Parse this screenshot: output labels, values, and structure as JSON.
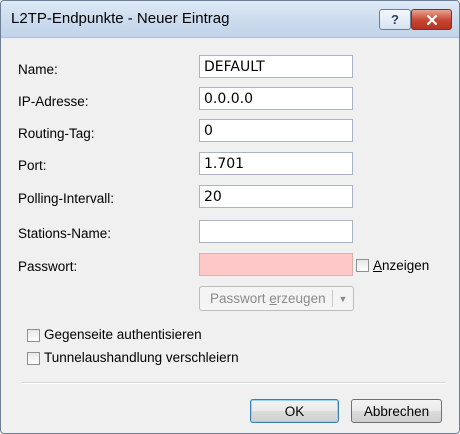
{
  "window": {
    "title": "L2TP-Endpunkte - Neuer Eintrag",
    "help_label": "?",
    "close_label": "✕"
  },
  "form": {
    "fields": [
      {
        "label": "Name:",
        "value": "DEFAULT"
      },
      {
        "label": "IP-Adresse:",
        "value": "0.0.0.0"
      },
      {
        "label": "Routing-Tag:",
        "value": "0"
      },
      {
        "label": "Port:",
        "value": "1.701"
      },
      {
        "label": "Polling-Intervall:",
        "value": "20"
      },
      {
        "label": "Stations-Name:",
        "value": ""
      },
      {
        "label": "Passwort:",
        "value": ""
      }
    ],
    "show_password": {
      "label_accel": "A",
      "label_rest": "nzeigen",
      "checked": false
    },
    "generate_button": {
      "label_pre": "Passwort ",
      "label_accel": "e",
      "label_post": "rzeugen"
    },
    "authenticate_peer": {
      "label": "Gegenseite authentisieren",
      "checked": false
    },
    "obfuscate_tunnel": {
      "label": "Tunnelaushandlung verschleiern",
      "checked": false
    }
  },
  "buttons": {
    "ok": "OK",
    "cancel": "Abbrechen"
  },
  "colors": {
    "password_field_bg": "#ffc8c8",
    "close_button": "#c6452f"
  }
}
